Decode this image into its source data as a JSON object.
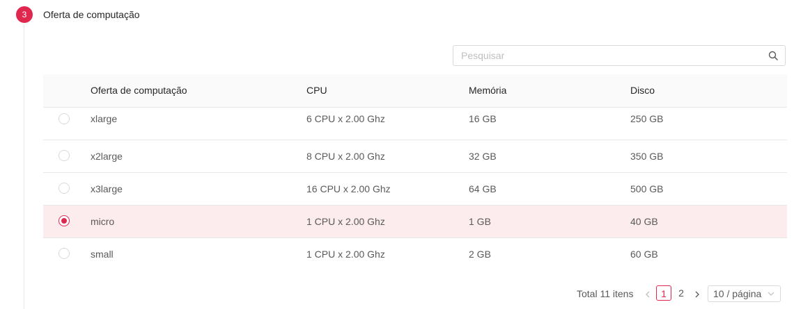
{
  "step": {
    "number": "3",
    "title": "Oferta de computação",
    "accent_color": "#e0284f"
  },
  "search": {
    "placeholder": "Pesquisar",
    "value": "",
    "icon": "search-icon"
  },
  "table": {
    "headers": {
      "name": "Oferta de computação",
      "cpu": "CPU",
      "memory": "Memória",
      "disk": "Disco"
    },
    "rows": [
      {
        "name": "xlarge",
        "cpu": "6 CPU x 2.00 Ghz",
        "memory": "16 GB",
        "disk": "250 GB",
        "selected": false
      },
      {
        "name": "x2large",
        "cpu": "8 CPU x 2.00 Ghz",
        "memory": "32 GB",
        "disk": "350 GB",
        "selected": false
      },
      {
        "name": "x3large",
        "cpu": "16 CPU x 2.00 Ghz",
        "memory": "64 GB",
        "disk": "500 GB",
        "selected": false
      },
      {
        "name": "micro",
        "cpu": "1 CPU x 2.00 Ghz",
        "memory": "1 GB",
        "disk": "40 GB",
        "selected": true
      },
      {
        "name": "small",
        "cpu": "1 CPU x 2.00 Ghz",
        "memory": "2 GB",
        "disk": "60 GB",
        "selected": false
      }
    ]
  },
  "pagination": {
    "total": "Total 11 itens",
    "prev": "<",
    "next": ">",
    "pages": [
      "1",
      "2"
    ],
    "current_page": "1",
    "page_size": "10 / página"
  }
}
